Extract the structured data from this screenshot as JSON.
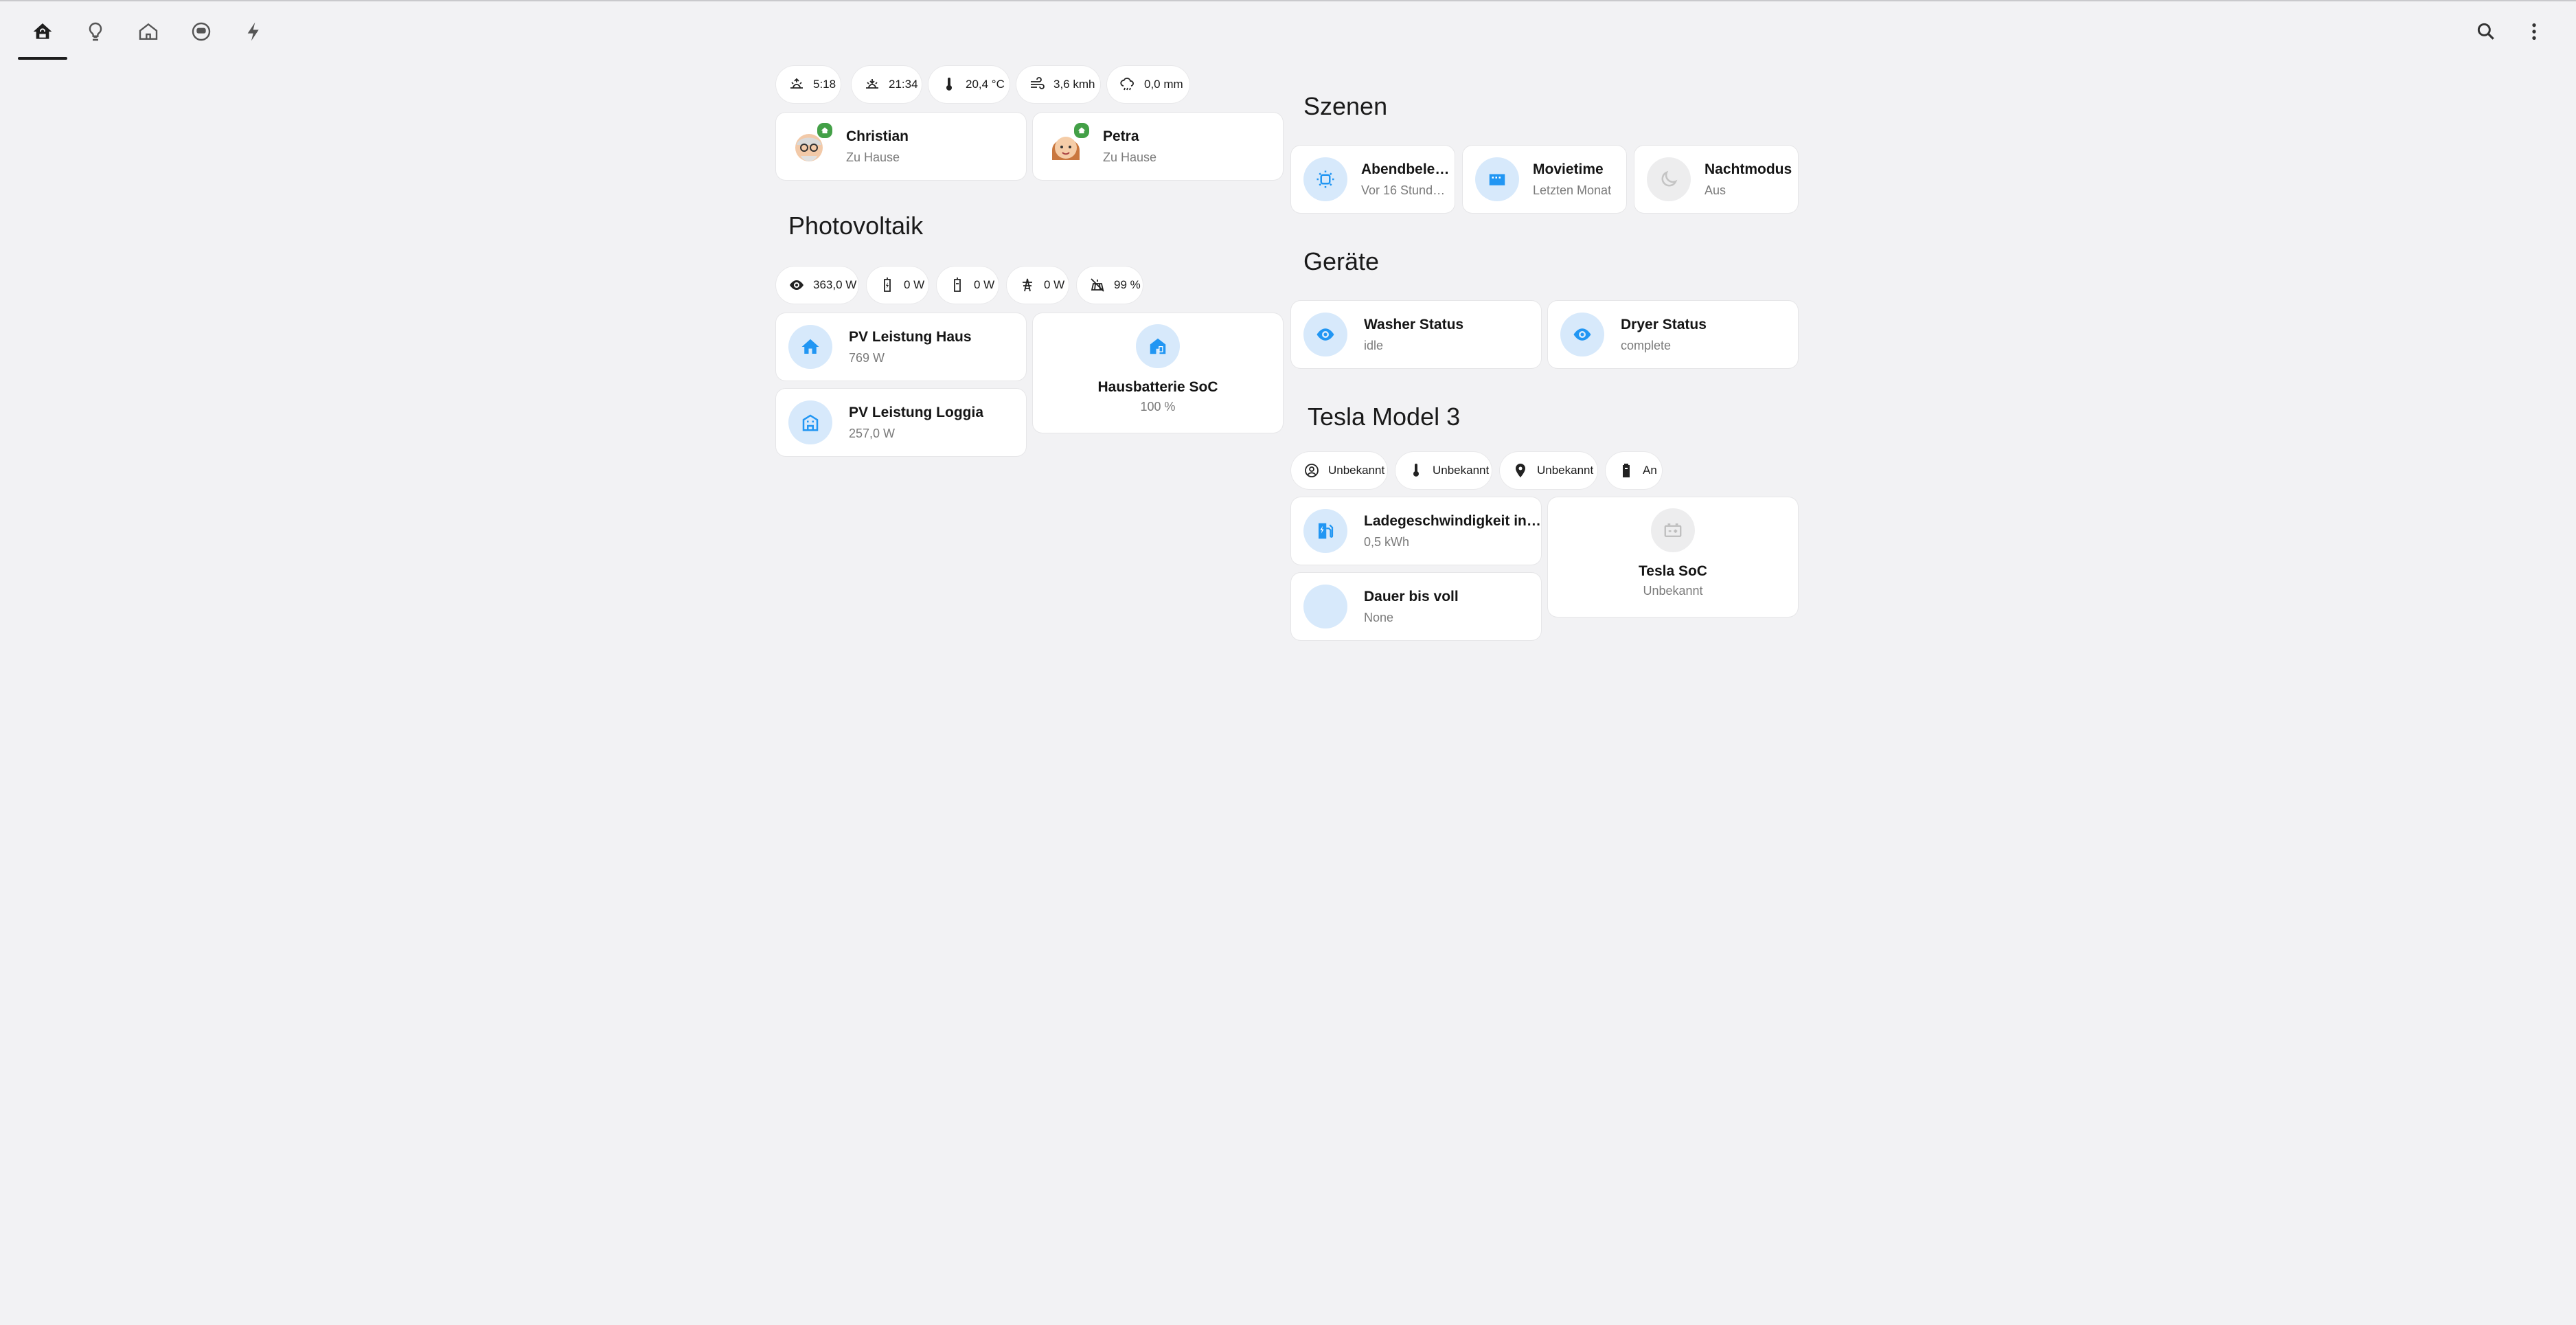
{
  "nav": {
    "tabs": [
      {
        "name": "home-tab",
        "icon": "home-automation-icon"
      },
      {
        "name": "lights-tab",
        "icon": "lightbulb-icon"
      },
      {
        "name": "house-tab",
        "icon": "house-outline-icon"
      },
      {
        "name": "robot-tab",
        "icon": "robot-vacuum-icon"
      },
      {
        "name": "energy-tab",
        "icon": "lightning-bolt-icon"
      }
    ],
    "actions": [
      {
        "name": "search-button",
        "icon": "search-icon"
      },
      {
        "name": "menu-button",
        "icon": "dots-vertical-icon"
      }
    ]
  },
  "top_chips": [
    {
      "icon": "sunrise-icon",
      "value": "5:18"
    },
    {
      "icon": "sunset-icon",
      "value": "21:34"
    },
    {
      "icon": "thermometer-icon",
      "value": "20,4 °C"
    },
    {
      "icon": "wind-icon",
      "value": "3,6 kmh"
    },
    {
      "icon": "rain-icon",
      "value": "0,0 mm"
    }
  ],
  "persons": [
    {
      "name": "Christian",
      "state": "Zu Hause"
    },
    {
      "name": "Petra",
      "state": "Zu Hause"
    }
  ],
  "photovoltaik": {
    "title": "Photovoltaik",
    "chips": [
      {
        "icon": "eye-icon",
        "value": "363,0 W"
      },
      {
        "icon": "battery-charging-icon",
        "value": "0 W"
      },
      {
        "icon": "battery-discharging-icon",
        "value": "0 W"
      },
      {
        "icon": "transmission-tower-icon",
        "value": "0 W"
      },
      {
        "icon": "solar-off-icon",
        "value": "99 %"
      }
    ],
    "tiles": [
      {
        "title": "PV Leistung Haus",
        "value": "769 W",
        "icon": "home-icon"
      },
      {
        "title": "PV Leistung Loggia",
        "value": "257,0 W",
        "icon": "building-icon"
      }
    ],
    "battery": {
      "title": "Hausbatterie SoC",
      "value": "100 %",
      "icon": "home-battery-icon"
    }
  },
  "szenen": {
    "title": "Szenen",
    "tiles": [
      {
        "title": "Abendbele…",
        "sub": "Vor 16 Stund…",
        "icon": "sun-dots-icon"
      },
      {
        "title": "Movietime",
        "sub": "Letzten Monat",
        "icon": "movie-icon"
      },
      {
        "title": "Nachtmodus",
        "sub": "Aus",
        "icon": "moon-icon"
      }
    ]
  },
  "geraete": {
    "title": "Geräte",
    "tiles": [
      {
        "title": "Washer Status",
        "sub": "idle",
        "icon": "eye-icon"
      },
      {
        "title": "Dryer Status",
        "sub": "complete",
        "icon": "eye-icon"
      }
    ]
  },
  "tesla": {
    "title": "Tesla Model 3",
    "chips": [
      {
        "icon": "account-circle-icon",
        "value": "Unbekannt"
      },
      {
        "icon": "thermometer-icon",
        "value": "Unbekannt"
      },
      {
        "icon": "map-marker-icon",
        "value": "Unbekannt"
      },
      {
        "icon": "battery-icon",
        "value": "An"
      }
    ],
    "tiles": [
      {
        "title": "Ladegeschwindigkeit in …",
        "sub": "0,5 kWh",
        "icon": "ev-station-icon"
      },
      {
        "title": "Dauer bis voll",
        "sub": "None",
        "icon": "none"
      }
    ],
    "soc": {
      "title": "Tesla SoC",
      "value": "Unbekannt",
      "icon": "car-battery-icon"
    }
  },
  "colors": {
    "accent": "#2196f3",
    "icon_bg": "#d7e9fb",
    "background": "#f2f2f4",
    "badge": "#43a047"
  }
}
